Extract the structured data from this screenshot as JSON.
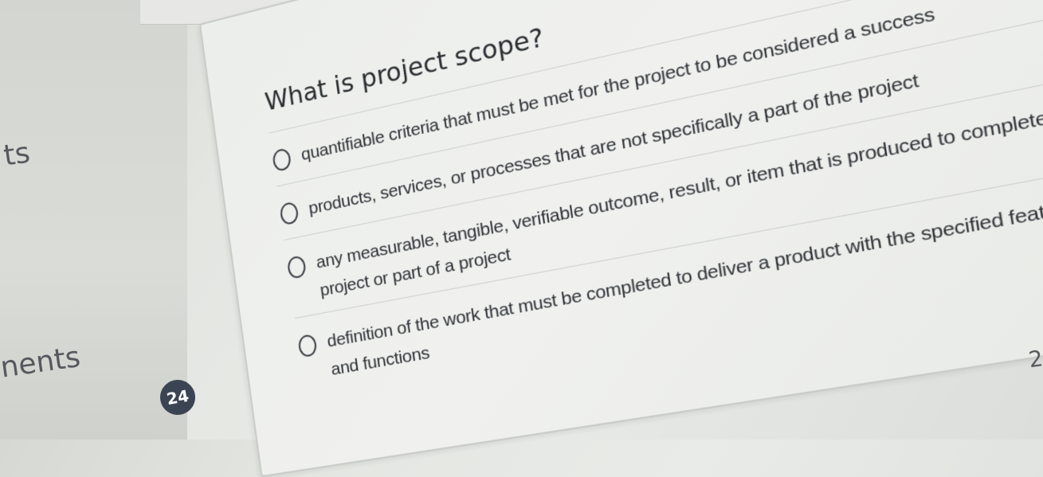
{
  "sidebar": {
    "items": [
      {
        "label": "ts"
      },
      {
        "label": "nents"
      }
    ]
  },
  "question": {
    "number_badge": "24",
    "title": "What is project scope?",
    "options": [
      {
        "label": "quantifiable criteria that must be met for the project to be considered a success"
      },
      {
        "label": "products, services, or processes that are not specifically a part of the project"
      },
      {
        "label": "any measurable, tangible, verifiable outcome, result, or item that is produced to complete a project or part of a project"
      },
      {
        "label": "definition of the work that must be completed to deliver a product with the specified features and functions"
      }
    ]
  },
  "next_question_number": "2"
}
